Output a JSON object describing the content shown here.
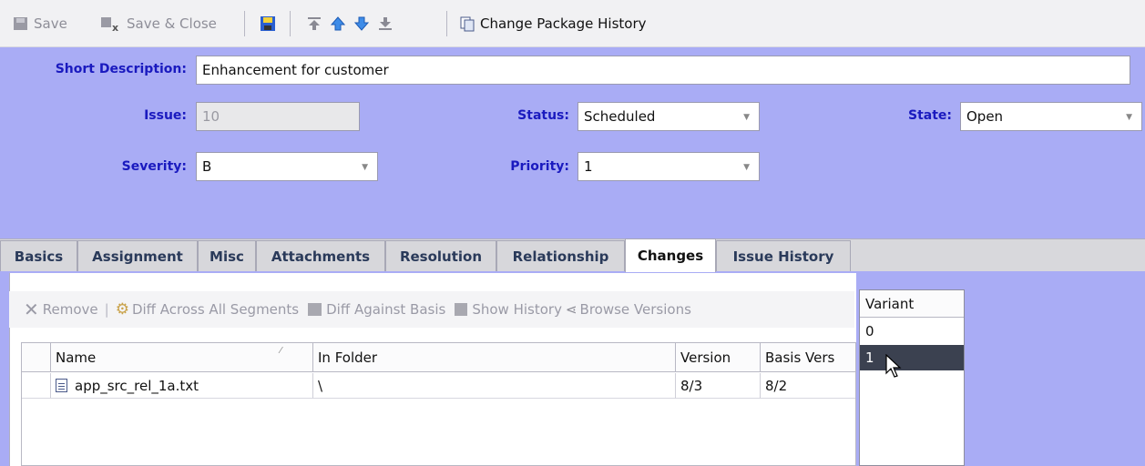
{
  "toolbar": {
    "save": "Save",
    "save_close": "Save & Close",
    "change_pkg": "Change Package History"
  },
  "form": {
    "short_desc_label": "Short Description:",
    "short_desc_value": "Enhancement for customer",
    "issue_label": "Issue:",
    "issue_value": "10",
    "status_label": "Status:",
    "status_value": "Scheduled",
    "state_label": "State:",
    "state_value": "Open",
    "severity_label": "Severity:",
    "severity_value": "B",
    "priority_label": "Priority:",
    "priority_value": "1"
  },
  "tabs": [
    "Basics",
    "Assignment",
    "Misc",
    "Attachments",
    "Resolution",
    "Relationship",
    "Changes",
    "Issue History"
  ],
  "active_tab": "Changes",
  "changes_toolbar": {
    "remove": "Remove",
    "diff_all": "Diff Across All Segments",
    "diff_basis": "Diff Against Basis",
    "show_history": "Show History",
    "browse_versions": "Browse Versions"
  },
  "table": {
    "columns": [
      "Name",
      "In Folder",
      "Version",
      "Basis Vers"
    ],
    "rows": [
      {
        "name": "app_src_rel_1a.txt",
        "folder": "\\",
        "version": "8/3",
        "basis": "8/2"
      }
    ]
  },
  "variant": {
    "header": "Variant",
    "options": [
      "0",
      "1"
    ],
    "selected": "1"
  },
  "colors": {
    "header_bg": "#a9acf5",
    "label": "#1a1abf",
    "selected_row": "#3b4150"
  }
}
